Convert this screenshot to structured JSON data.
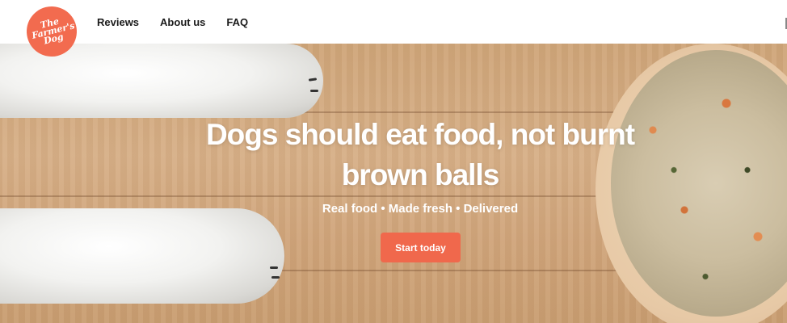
{
  "brand": {
    "logo_text": "The\nFarmer's\nDog",
    "color": "#f26b4f"
  },
  "nav": {
    "items": [
      "Reviews",
      "About us",
      "FAQ"
    ]
  },
  "hero": {
    "headline": "Dogs should eat food, not burnt brown balls",
    "subhead": "Real food • Made fresh • Delivered",
    "cta_label": "Start today",
    "cta_color": "#f0684c"
  }
}
